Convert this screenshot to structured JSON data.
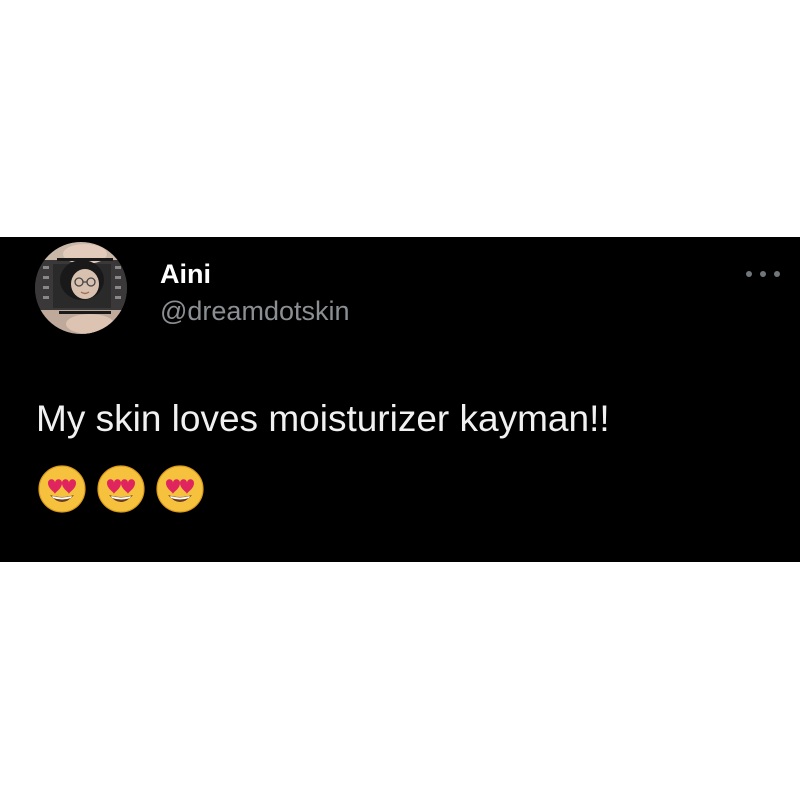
{
  "tweet": {
    "author": {
      "display_name": "Aini",
      "handle": "@dreamdotskin",
      "avatar_icon": "profile-photo"
    },
    "more_icon": "ellipsis-icon",
    "text": "My skin loves moisturizer kayman!!",
    "emojis": [
      "heart-eyes-emoji",
      "heart-eyes-emoji",
      "heart-eyes-emoji"
    ]
  },
  "colors": {
    "page_background": "#ffffff",
    "card_background": "#000000",
    "name_text": "#ffffff",
    "handle_text": "#8b8f93",
    "body_text": "#f1f1f1",
    "more_icon": "#71767b"
  }
}
